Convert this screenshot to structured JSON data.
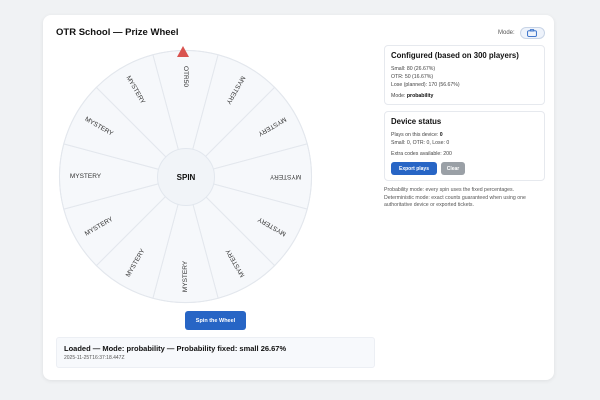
{
  "app": {
    "title": "OTR School — Prize Wheel"
  },
  "header": {
    "mode_label": "Mode:",
    "mode_icon": "toolbox-icon"
  },
  "wheel": {
    "segments": [
      "OTR50",
      "MYSTERY",
      "MYSTERY",
      "MYSTERY",
      "MYSTERY",
      "MYSTERY",
      "MYSTERY",
      "MYSTERY",
      "MYSTERY",
      "MYSTERY",
      "MYSTERY",
      "MYSTERY"
    ],
    "hub_label": "SPIN",
    "segment_color": "#f6f8fb",
    "border_color": "#e3e7ed",
    "pointer_color": "#d9534f"
  },
  "spin_button": {
    "label": "Spin the Wheel"
  },
  "status": {
    "message": "Loaded — Mode: probability — Probability fixed: small 26.67%",
    "timestamp": "2025-11-25T16:37:18.447Z"
  },
  "configured": {
    "title": "Configured (based on 300 players)",
    "small": "Small: 80 (26.67%)",
    "otr": "OTR: 50 (16.67%)",
    "lose": "Lose (planned): 170 (56.67%)",
    "mode_prefix": "Mode:",
    "mode_value": "probability"
  },
  "device": {
    "title": "Device status",
    "plays_prefix": "Plays on this device:",
    "plays_value": "0",
    "counts": "Small: 0, OTR: 0, Lose: 0",
    "extra": "Extra codes available: 200",
    "export_label": "Export plays",
    "clear_label": "Clear"
  },
  "note": "Probability mode: every spin uses the fixed percentages. Deterministic mode: exact counts guaranteed when using one authoritative device or exported tickets.",
  "colors": {
    "accent": "#2765c5",
    "clear": "#9aa0a6"
  }
}
